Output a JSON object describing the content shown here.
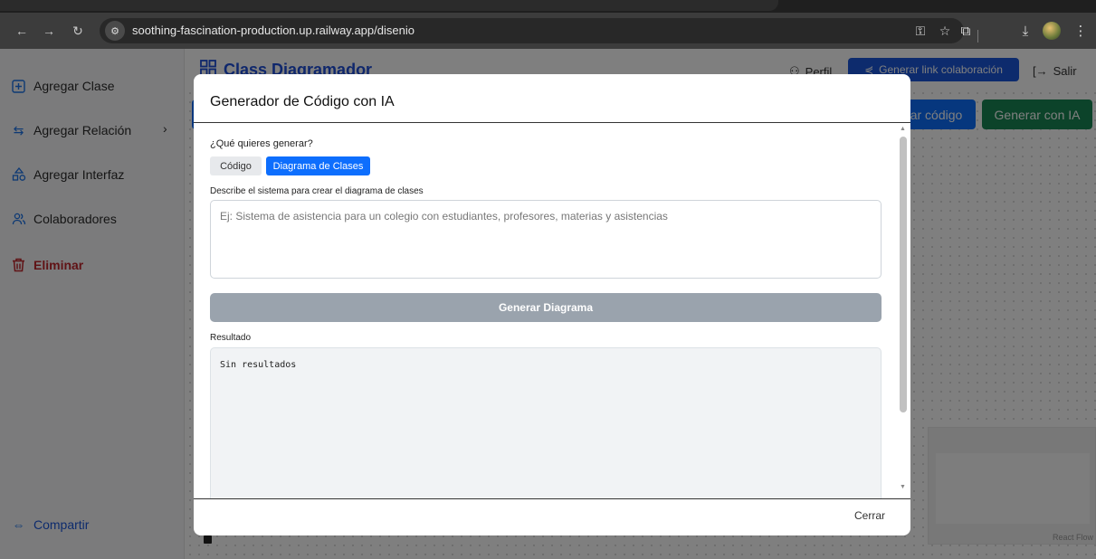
{
  "browser": {
    "url": "soothing-fascination-production.up.railway.app/disenio",
    "icons": [
      "back-icon",
      "forward-icon",
      "reload-icon",
      "site-settings-icon",
      "key-icon",
      "star-icon",
      "extensions-icon",
      "download-icon",
      "profile-avatar",
      "menu-icon"
    ]
  },
  "sidebar": {
    "items": [
      {
        "label": "Agregar Clase",
        "icon": "plus-square-icon"
      },
      {
        "label": "Agregar Relación",
        "icon": "arrows-swap-icon"
      },
      {
        "label": "Agregar Interfaz",
        "icon": "shapes-icon"
      },
      {
        "label": "Colaboradores",
        "icon": "users-icon"
      },
      {
        "label": "Eliminar",
        "icon": "trash-icon"
      }
    ],
    "share_label": "Compartir"
  },
  "header": {
    "title": "Class Diagramador",
    "profile_label": "Perfil",
    "collab_label": "Generar link colaboración",
    "logout_label": "Salir"
  },
  "toolbar": {
    "gen_code_label": "ar código",
    "gen_ia_label": "Generar con IA"
  },
  "canvas": {
    "attribution": "React Flow"
  },
  "modal": {
    "title": "Generador de Código con IA",
    "question": "¿Qué quieres generar?",
    "tabs": [
      "Código",
      "Diagrama de Clases"
    ],
    "selected_tab": "Diagrama de Clases",
    "description_label": "Describe el sistema para crear el diagrama de clases",
    "description_placeholder": "Ej: Sistema de asistencia para un colegio con estudiantes, profesores, materias y asistencias",
    "description_value": "",
    "generate_label": "Generar Diagrama",
    "result_label": "Resultado",
    "result_text": "Sin resultados",
    "close_label": "Cerrar"
  },
  "colors": {
    "primary": "#0d6efd",
    "success": "#198754",
    "danger": "#c0262d",
    "disabled": "#9aa3ad"
  }
}
